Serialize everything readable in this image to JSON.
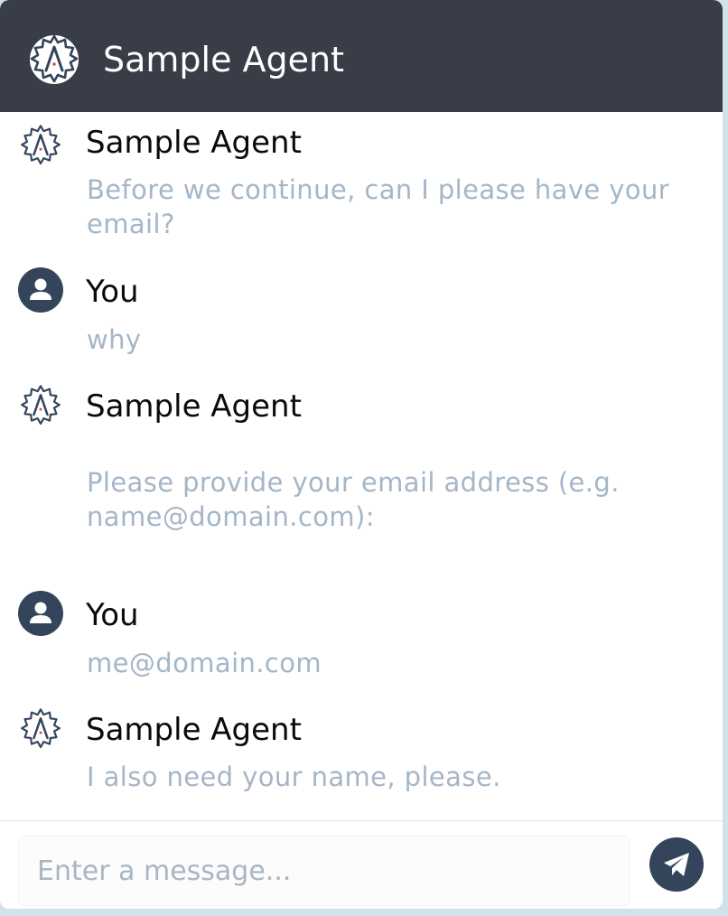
{
  "header": {
    "title": "Sample Agent",
    "logo_icon": "agent-gear-logo-icon"
  },
  "messages": [
    {
      "sender": "Sample Agent",
      "role": "agent",
      "text": "Before we continue, can I please have your email?"
    },
    {
      "sender": "You",
      "role": "user",
      "text": "why"
    },
    {
      "sender": "Sample Agent",
      "role": "agent",
      "text": "Please provide your email address (e.g. name@domain.com):"
    },
    {
      "sender": "You",
      "role": "user",
      "text": "me@domain.com"
    },
    {
      "sender": "Sample Agent",
      "role": "agent",
      "text": "I also need your name, please."
    }
  ],
  "composer": {
    "placeholder": "Enter a message...",
    "send_icon": "paper-plane-icon"
  },
  "colors": {
    "header_bg": "#393d47",
    "message_text": "#a4b6c8",
    "sender_text": "#0a0a0a",
    "avatar": "#34455b",
    "page_bg": "#cfe3ea"
  }
}
